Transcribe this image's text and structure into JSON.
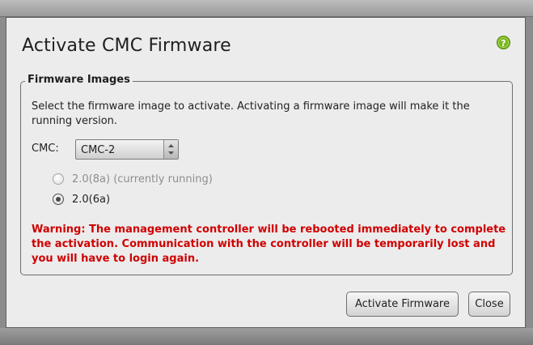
{
  "dialog": {
    "title": "Activate CMC Firmware",
    "help_icon": "help-question-icon"
  },
  "group": {
    "legend": "Firmware Images",
    "description": "Select the firmware image to activate. Activating a firmware image will make it the running version."
  },
  "cmc": {
    "label": "CMC:",
    "selected": "CMC-2"
  },
  "versions": [
    {
      "label": "2.0(8a) (currently running)",
      "selected": false,
      "enabled": false
    },
    {
      "label": "2.0(6a)",
      "selected": true,
      "enabled": true
    }
  ],
  "warning": "Warning: The management controller will be rebooted immediately to complete the activation. Communication with the controller will be temporarily lost and you will have to login again.",
  "buttons": {
    "activate": "Activate Firmware",
    "close": "Close"
  },
  "colors": {
    "warning": "#d00000",
    "help_icon": "#7ab51d"
  }
}
